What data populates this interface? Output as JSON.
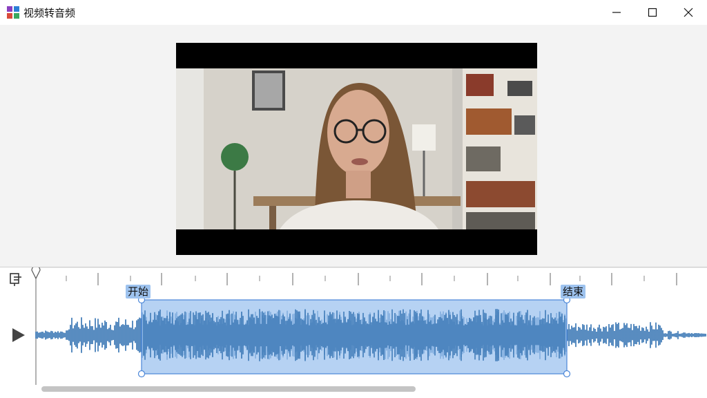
{
  "window": {
    "title": "视频转音频",
    "icon": "app-icon",
    "controls": [
      "minimize-icon",
      "maximize-icon",
      "close-icon"
    ]
  },
  "video": {
    "frame": "video-frame"
  },
  "timeline": {
    "start_label": "开始",
    "end_label": "结束",
    "selection_color": "#9ec3ef",
    "waveform_color": "#2f6fb0",
    "tool_icon": "trim-icon",
    "play_icon": "play-icon"
  }
}
